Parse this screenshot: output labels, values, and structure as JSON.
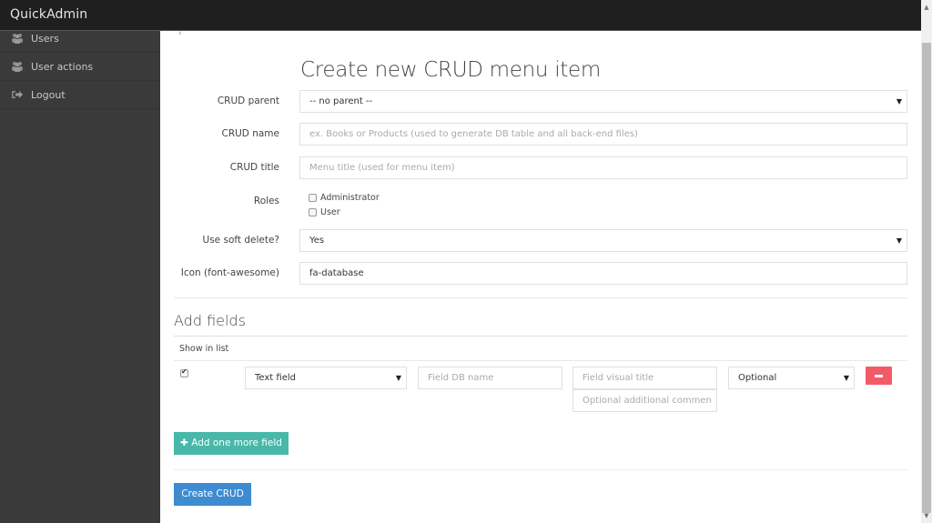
{
  "app": {
    "brand": "QuickAdmin"
  },
  "sidebar": {
    "items": [
      {
        "label": "Users",
        "icon": "users-icon"
      },
      {
        "label": "User actions",
        "icon": "users-icon"
      },
      {
        "label": "Logout",
        "icon": "sign-out-icon"
      }
    ]
  },
  "form": {
    "title": "Create new CRUD menu item",
    "crud_parent": {
      "label": "CRUD parent",
      "value": "-- no parent --"
    },
    "crud_name": {
      "label": "CRUD name",
      "placeholder": "ex. Books or Products (used to generate DB table and all back-end files)"
    },
    "crud_title": {
      "label": "CRUD title",
      "placeholder": "Menu title (used for menu item)"
    },
    "roles": {
      "label": "Roles",
      "options": [
        {
          "label": "Administrator",
          "checked": false
        },
        {
          "label": "User",
          "checked": false
        }
      ]
    },
    "soft_delete": {
      "label": "Use soft delete?",
      "value": "Yes"
    },
    "icon": {
      "label": "Icon (font-awesome)",
      "value": "fa-database"
    }
  },
  "fields": {
    "title": "Add fields",
    "column_header": "Show in list",
    "rows": [
      {
        "show_in_list": true,
        "type": "Text field",
        "db_name_placeholder": "Field DB name",
        "visual_title_placeholder": "Field visual title",
        "comment_placeholder": "Optional additional commen",
        "validation": "Optional"
      }
    ],
    "add_button": "Add one more field"
  },
  "submit": {
    "label": "Create CRUD"
  },
  "colors": {
    "add": "#47b8a9",
    "create": "#3d8bd1",
    "remove": "#f25a66",
    "topbar": "#1f1f1f",
    "sidebar": "#3a3a3a"
  }
}
